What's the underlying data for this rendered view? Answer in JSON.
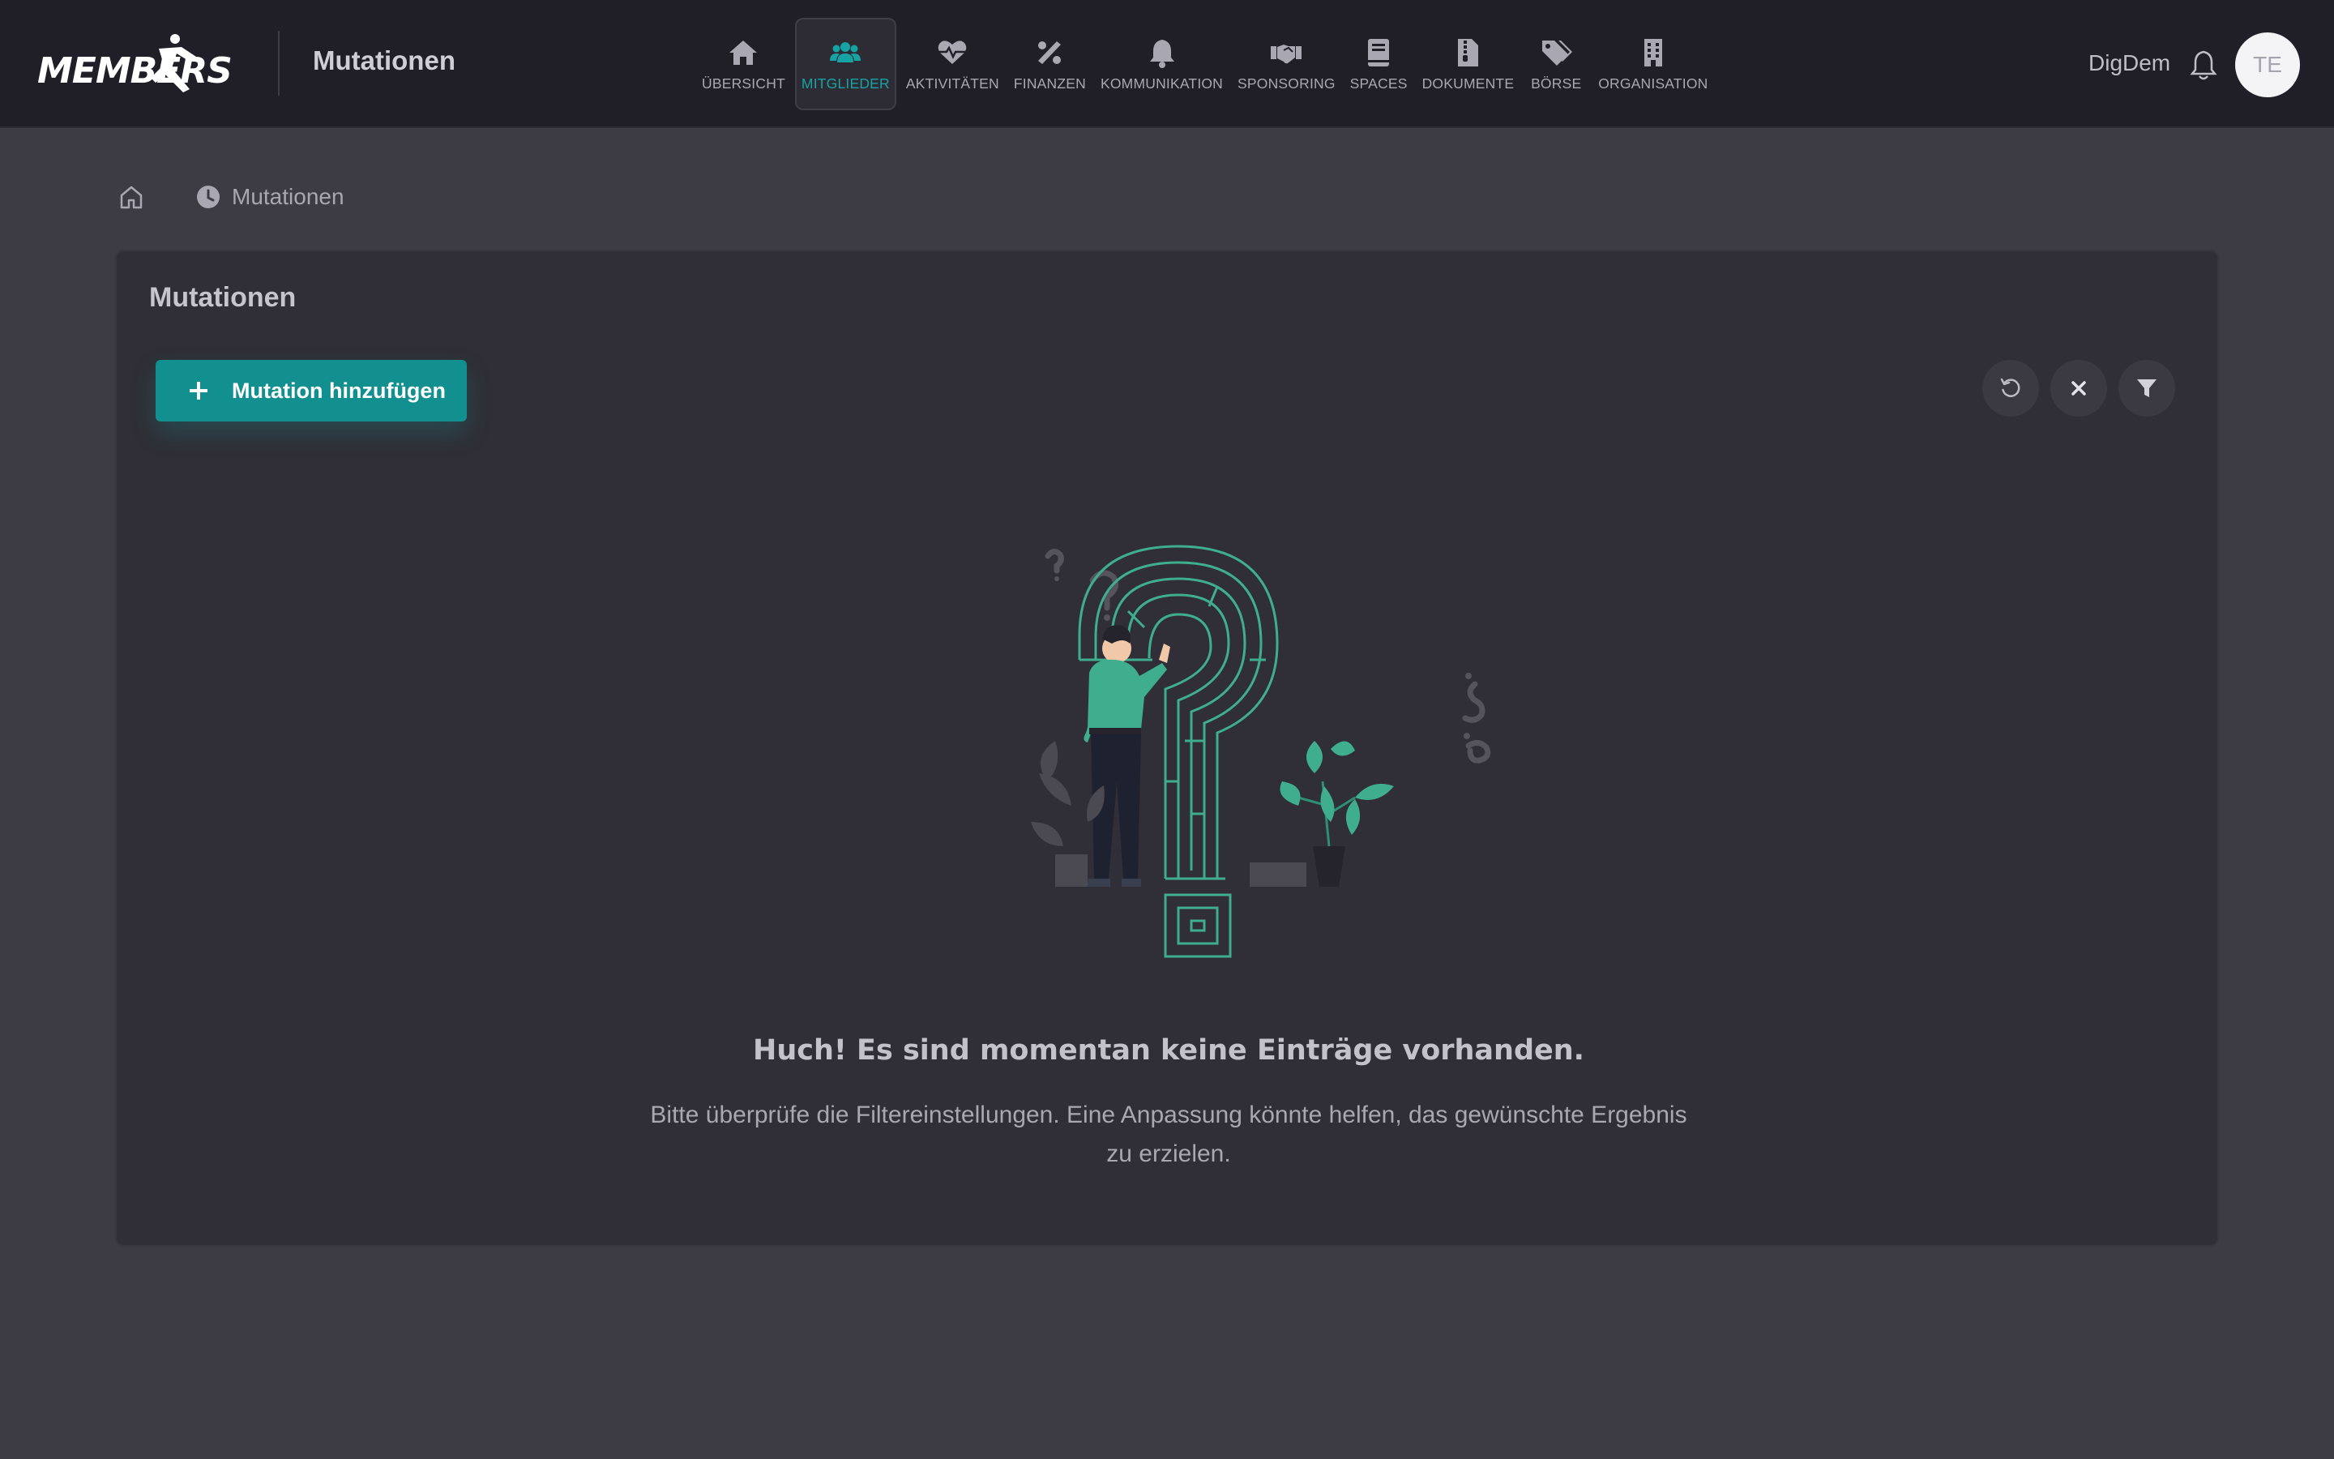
{
  "app": {
    "logo": "MEMBERS",
    "title": "Mutationen"
  },
  "nav": [
    {
      "label": "ÜBERSICHT",
      "icon": "home-icon",
      "active": false
    },
    {
      "label": "MITGLIEDER",
      "icon": "users-icon",
      "active": true
    },
    {
      "label": "AKTIVITÄTEN",
      "icon": "heartbeat-icon",
      "active": false
    },
    {
      "label": "FINANZEN",
      "icon": "percent-icon",
      "active": false
    },
    {
      "label": "KOMMUNIKATION",
      "icon": "bell-icon",
      "active": false
    },
    {
      "label": "SPONSORING",
      "icon": "handshake-icon",
      "active": false
    },
    {
      "label": "SPACES",
      "icon": "book-icon",
      "active": false
    },
    {
      "label": "DOKUMENTE",
      "icon": "zip-file-icon",
      "active": false
    },
    {
      "label": "BÖRSE",
      "icon": "tags-icon",
      "active": false
    },
    {
      "label": "ORGANISATION",
      "icon": "building-icon",
      "active": false
    }
  ],
  "user": {
    "name": "DigDem",
    "initials": "TE"
  },
  "breadcrumb": {
    "current": "Mutationen"
  },
  "card": {
    "title": "Mutationen",
    "add_button": "Mutation hinzufügen"
  },
  "empty_state": {
    "title": "Huch! Es sind momentan keine Einträge vorhanden.",
    "text": "Bitte überprüfe die Filtereinstellungen. Eine Anpassung könnte helfen, das gewünschte Ergebnis zu erzielen."
  },
  "colors": {
    "accent": "#12908f",
    "active_nav": "#16a3a3",
    "topbar": "#201e26",
    "background": "#3d3b44",
    "card": "#302e36"
  }
}
